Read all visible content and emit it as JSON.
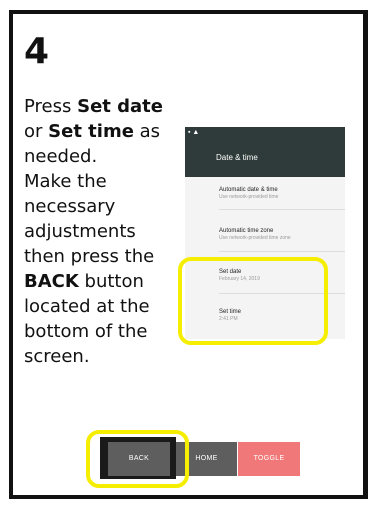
{
  "step": {
    "number": "4"
  },
  "instructions": {
    "l1_pre": "Press ",
    "l1_bold": "Set date",
    "l2_pre": "or ",
    "l2_bold": "Set time",
    "l2_post": " as",
    "l3": "needed.",
    "l4": "Make the",
    "l5": "necessary",
    "l6": "adjustments",
    "l7": "then press the",
    "l8_bold": "BACK",
    "l8_post": " button",
    "l9": "located at the",
    "l10": "bottom of the",
    "l11": "screen."
  },
  "phone": {
    "status_icons": "▪ ▲",
    "title": "Date & time",
    "settings": [
      {
        "title": "Automatic date & time",
        "subtitle": "Use network-provided time"
      },
      {
        "title": "Automatic time zone",
        "subtitle": "Use network-provided time zone"
      },
      {
        "title": "Set date",
        "subtitle": "February 14, 2019"
      },
      {
        "title": "Set time",
        "subtitle": "2:41 PM"
      }
    ]
  },
  "nav": {
    "back": "BACK",
    "home": "HOME",
    "toggle": "TOGGLE"
  },
  "colors": {
    "highlight": "#f5ee00",
    "header": "#2f3b3a",
    "nav_button": "#5e5e5e",
    "toggle_button": "#f07878"
  }
}
